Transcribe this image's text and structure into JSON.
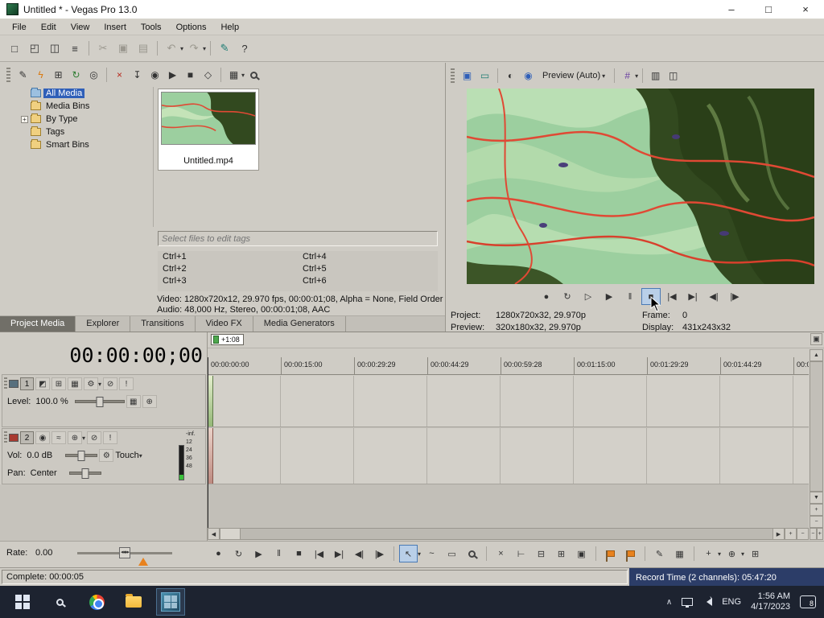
{
  "titlebar": {
    "title": "Untitled * - Vegas Pro 13.0"
  },
  "menus": [
    "File",
    "Edit",
    "View",
    "Insert",
    "Tools",
    "Options",
    "Help"
  ],
  "media_panel": {
    "tree": [
      "All Media",
      "Media Bins",
      "By Type",
      "Tags",
      "Smart Bins"
    ],
    "clip_name": "Untitled.mp4",
    "tags_placeholder": "Select files to edit tags",
    "shortcuts_left": [
      "Ctrl+1",
      "Ctrl+2",
      "Ctrl+3"
    ],
    "shortcuts_right": [
      "Ctrl+4",
      "Ctrl+5",
      "Ctrl+6"
    ],
    "video_info": "Video: 1280x720x12, 29.970 fps, 00:00:01;08, Alpha = None, Field Order",
    "audio_info": "Audio: 48,000 Hz, Stereo, 00:00:01;08, AAC",
    "tabs": [
      "Project Media",
      "Explorer",
      "Transitions",
      "Video FX",
      "Media Generators"
    ]
  },
  "preview": {
    "mode": "Preview (Auto)",
    "info": {
      "project_label": "Project:",
      "project": "1280x720x32, 29.970p",
      "frame_label": "Frame:",
      "frame": "0",
      "preview_label": "Preview:",
      "preview": "320x180x32, 29.970p",
      "display_label": "Display:",
      "display": "431x243x32"
    }
  },
  "timeline": {
    "time_display": "00:00:00;00",
    "marker": "+1:08",
    "ruler": [
      "00:00:00:00",
      "00:00:15:00",
      "00:00:29:29",
      "00:00:44:29",
      "00:00:59:28",
      "00:01:15:00",
      "00:01:29:29",
      "00:01:44:29",
      "00:0"
    ],
    "track1": {
      "number": "1",
      "level_label": "Level:",
      "level": "100.0 %"
    },
    "track2": {
      "number": "2",
      "vol_label": "Vol:",
      "vol": "0.0 dB",
      "mode": "Touch",
      "pan_label": "Pan:",
      "pan": "Center",
      "meter": [
        "-inf.",
        "12",
        "24",
        "36",
        "48"
      ]
    },
    "rate_label": "Rate:",
    "rate": "0.00"
  },
  "statusbar": {
    "left": "Complete: 00:00:05",
    "right": "Record Time (2 channels): 05:47:20"
  },
  "taskbar": {
    "lang": "ENG",
    "time": "1:56 AM",
    "date": "4/17/2023",
    "badge": "8"
  },
  "icons": {
    "minimize": "–",
    "maximize": "□",
    "close": "×",
    "caret": "▾",
    "expand": "+",
    "new": "□",
    "open": "◰",
    "save": "◫",
    "properties": "≡",
    "cut": "✂",
    "copy": "▣",
    "paste": "▤",
    "undo": "↶",
    "redo": "↷",
    "paint": "✎",
    "help": "?",
    "pencil": "✎",
    "lightning": "ϟ",
    "add_bin": "⊞",
    "sync": "↻",
    "web": "◎",
    "del": "×",
    "extract": "↧",
    "capture": "◉",
    "play_sm": "▶",
    "stop_sm": "■",
    "tag": "◇",
    "views": "▦",
    "proj": "▣",
    "monitor": "▭",
    "split": "◐",
    "overlay": "#",
    "copyf": "▥",
    "savef": "◫",
    "record": "●",
    "loop": "↻",
    "play_start": "▷",
    "play": "▶",
    "pause": "‖",
    "stop": "■",
    "go_start": "|◀",
    "go_end": "▶|",
    "prev": "◀|",
    "next": "|▶",
    "tool_normal": "↖",
    "tool_env": "~",
    "tool_select": "▭",
    "trim": "⊢",
    "split1": "⊟",
    "group": "⊞",
    "lock": "▣",
    "blur": "◩",
    "motion": "⊞",
    "fx": "▦",
    "gear": "⚙",
    "mute": "⊘",
    "solo": "!",
    "arm": "◉",
    "phase": "≈",
    "gain": "⊕",
    "pin": "▣",
    "up": "▲",
    "down": "▼",
    "left": "◀",
    "right": "▶",
    "plus": "+",
    "minus": "−",
    "rate_thumb": "◂◂▸▸"
  }
}
